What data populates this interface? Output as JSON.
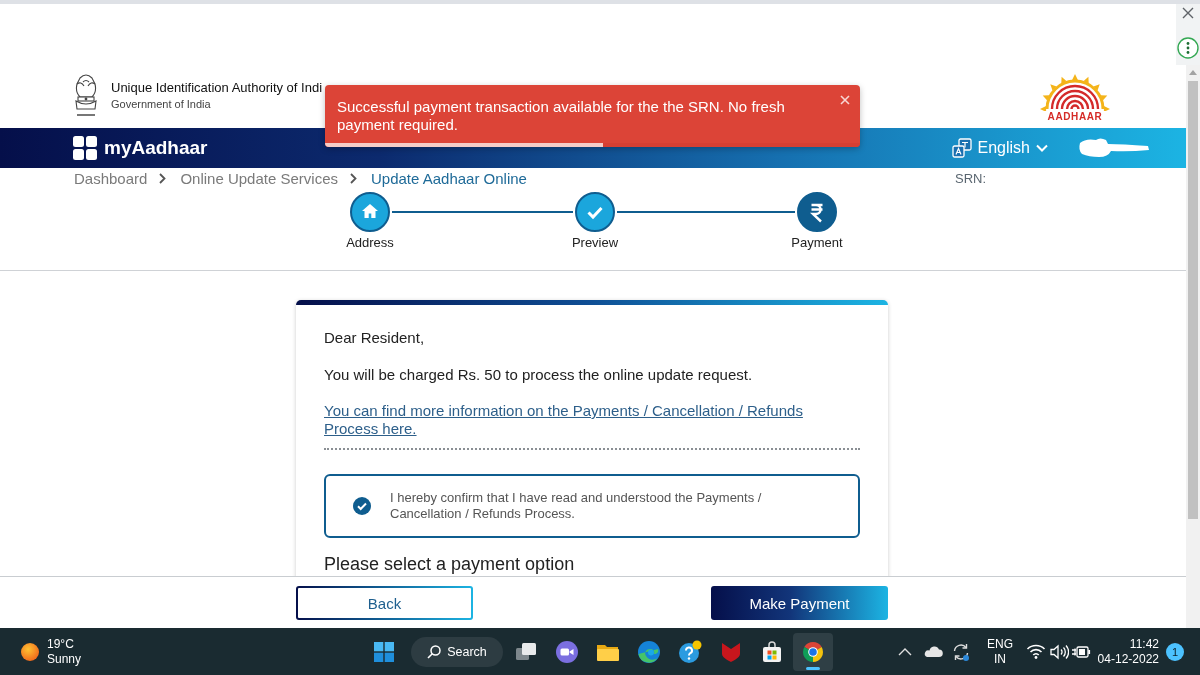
{
  "header": {
    "org_name": "Unique Identification Authority of Indi",
    "org_subtitle": "Government of India",
    "logo_text": "AADHAAR"
  },
  "navbar": {
    "brand": "myAadhaar",
    "language": "English"
  },
  "toast": {
    "message": "Successful payment transaction available for the the SRN. No fresh payment required.",
    "level": 0.52
  },
  "breadcrumb": [
    {
      "label": "Dashboard",
      "current": false
    },
    {
      "label": "Online Update Services",
      "current": false
    },
    {
      "label": "Update Aadhaar Online",
      "current": true
    }
  ],
  "srn_label": "SRN:",
  "steps": [
    {
      "label": "Address",
      "kind": "home",
      "current": false
    },
    {
      "label": "Preview",
      "kind": "check",
      "current": false
    },
    {
      "label": "Payment",
      "kind": "rupee",
      "current": true
    }
  ],
  "card": {
    "greeting": "Dear Resident,",
    "charge_notice": "You will be charged Rs. 50 to process the online update request.",
    "info_link": "You can find more information on the Payments / Cancellation / Refunds Process here.",
    "confirmation": {
      "checked": true,
      "text": "I hereby confirm that I have read and understood the Payments / Cancellation / Refunds Process."
    },
    "section_heading": "Please select a payment option"
  },
  "footer": {
    "back": "Back",
    "submit": "Make Payment"
  },
  "taskbar": {
    "weather": {
      "temperature": "19°C",
      "condition": "Sunny"
    },
    "search": "Search",
    "apps": [
      {
        "kind": "taskview",
        "active": false
      },
      {
        "kind": "chat",
        "active": false
      },
      {
        "kind": "folder",
        "active": false
      },
      {
        "kind": "swirl",
        "active": false
      },
      {
        "kind": "help",
        "active": false
      },
      {
        "kind": "shield",
        "active": false
      },
      {
        "kind": "store",
        "active": false
      },
      {
        "kind": "browser",
        "active": true
      }
    ],
    "language": "ENG",
    "region": "IN",
    "time": "11:42",
    "date": "04-12-2022",
    "notifications": "1"
  }
}
